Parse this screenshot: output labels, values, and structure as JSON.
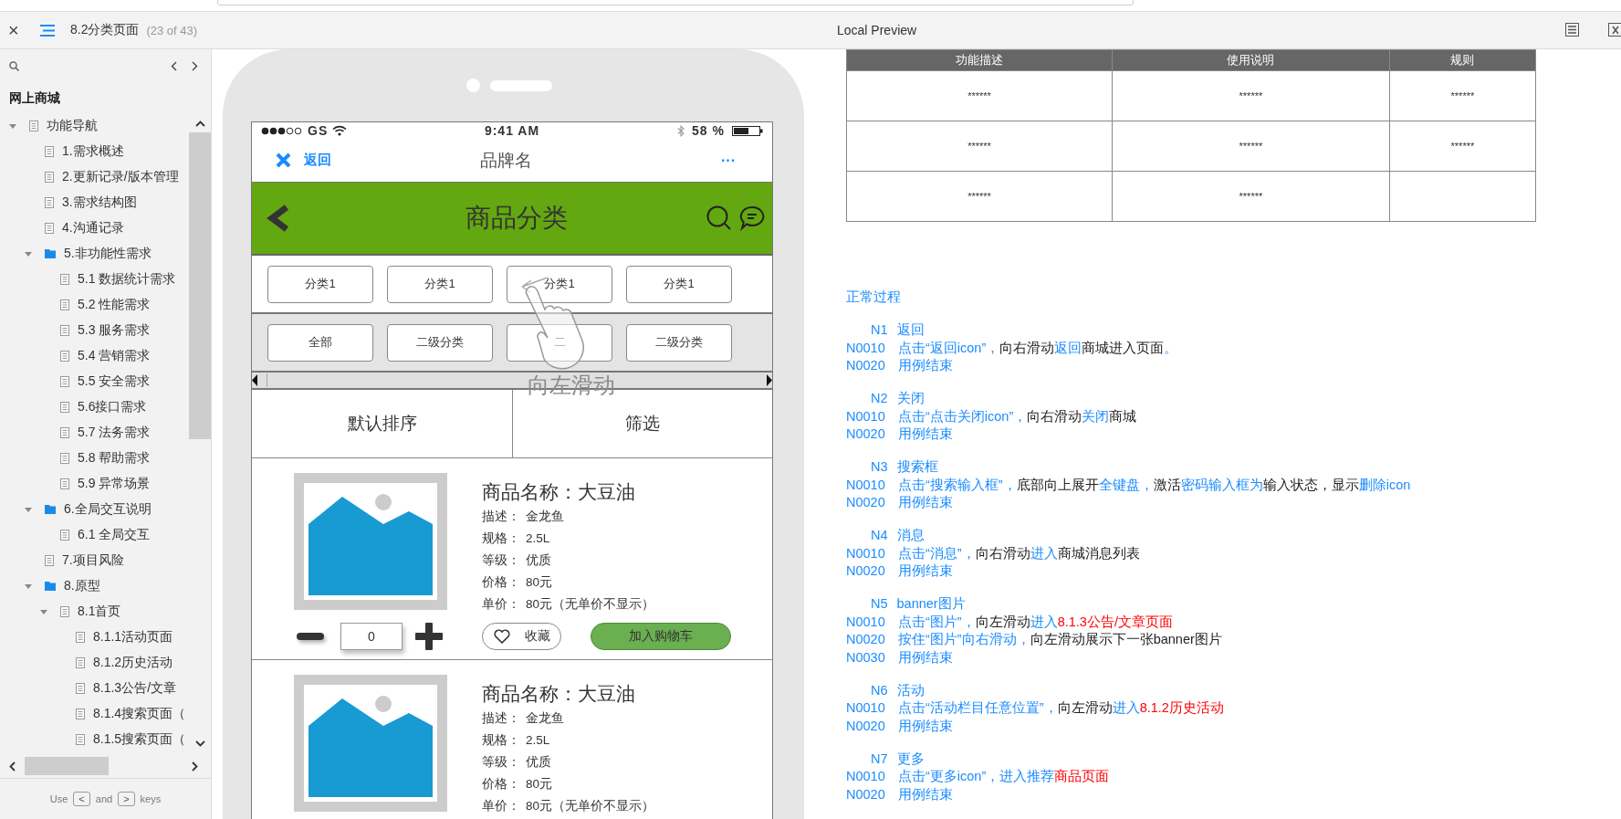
{
  "toolbar": {
    "close": "×",
    "page_title": "8.2分类页面",
    "page_count": "(23 of 43)",
    "center_title": "Local Preview"
  },
  "sidebar": {
    "project": "网上商城",
    "tree": [
      {
        "label": "功能导航",
        "kind": "page",
        "expanded": true,
        "children": [
          {
            "label": "1.需求概述",
            "kind": "page"
          },
          {
            "label": "2.更新记录/版本管理",
            "kind": "page"
          },
          {
            "label": "3.需求结构图",
            "kind": "page"
          },
          {
            "label": "4.沟通记录",
            "kind": "page"
          },
          {
            "label": "5.非功能性需求",
            "kind": "folder",
            "expanded": true,
            "children": [
              {
                "label": "5.1 数据统计需求",
                "kind": "page"
              },
              {
                "label": "5.2 性能需求",
                "kind": "page"
              },
              {
                "label": "5.3 服务需求",
                "kind": "page"
              },
              {
                "label": "5.4 营销需求",
                "kind": "page"
              },
              {
                "label": "5.5 安全需求",
                "kind": "page"
              },
              {
                "label": "5.6接口需求",
                "kind": "page"
              },
              {
                "label": "5.7 法务需求",
                "kind": "page"
              },
              {
                "label": "5.8 帮助需求",
                "kind": "page"
              },
              {
                "label": "5.9 异常场景",
                "kind": "page"
              }
            ]
          },
          {
            "label": "6.全局交互说明",
            "kind": "folder",
            "expanded": true,
            "children": [
              {
                "label": "6.1 全局交互",
                "kind": "page"
              }
            ]
          },
          {
            "label": "7.项目风险",
            "kind": "page"
          },
          {
            "label": "8.原型",
            "kind": "folder",
            "expanded": true,
            "children": [
              {
                "label": "8.1首页",
                "kind": "page",
                "expanded": true,
                "children": [
                  {
                    "label": "8.1.1活动页面",
                    "kind": "page"
                  },
                  {
                    "label": "8.1.2历史活动",
                    "kind": "page"
                  },
                  {
                    "label": "8.1.3公告/文章",
                    "kind": "page"
                  },
                  {
                    "label": "8.1.4搜索页面（",
                    "kind": "page"
                  },
                  {
                    "label": "8.1.5搜索页面（",
                    "kind": "page"
                  }
                ]
              }
            ]
          }
        ]
      }
    ],
    "footer": {
      "use": "Use",
      "prev_key": "<",
      "and": "and",
      "next_key": ">",
      "keys": "keys"
    }
  },
  "phone": {
    "status": {
      "carrier": "GS",
      "time": "9:41 AM",
      "battery": "58 %"
    },
    "nav": {
      "back_label": "返回",
      "title": "品牌名",
      "more": "···"
    },
    "header": {
      "title": "商品分类"
    },
    "categories": [
      "分类1",
      "分类1",
      "分类1",
      "分类1"
    ],
    "subcategories": [
      "全部",
      "二级分类",
      "二",
      "二级分类"
    ],
    "gesture_hint": "向左滑动",
    "sort": [
      "默认排序",
      "筛选"
    ],
    "products": [
      {
        "name": "商品名称：大豆油",
        "details": [
          {
            "label": "描述：",
            "value": "金龙鱼"
          },
          {
            "label": "规格：",
            "value": "2.5L"
          },
          {
            "label": "等级：",
            "value": "优质"
          },
          {
            "label": "价格：",
            "value": "80元"
          },
          {
            "label": "单价：",
            "value": "80元（无单价不显示）"
          }
        ],
        "quantity": "0",
        "favorite": "收藏",
        "add_to_cart": "加入购物车"
      },
      {
        "name": "商品名称：大豆油",
        "details": [
          {
            "label": "描述：",
            "value": "金龙鱼"
          },
          {
            "label": "规格：",
            "value": "2.5L"
          },
          {
            "label": "等级：",
            "value": "优质"
          },
          {
            "label": "价格：",
            "value": "80元"
          },
          {
            "label": "单价：",
            "value": "80元（无单价不显示）"
          }
        ]
      }
    ]
  },
  "spec_table": {
    "columns": [
      "功能描述",
      "使用说明",
      "规则"
    ],
    "rows": [
      [
        "******",
        "******",
        "******"
      ],
      [
        "******",
        "******",
        "******"
      ],
      [
        "******",
        "******"
      ]
    ]
  },
  "flow": {
    "title": "正常过程",
    "groups": [
      {
        "id": "N1",
        "title": "返回",
        "steps": [
          {
            "code": "N0010",
            "parts": [
              {
                "kind": "link",
                "text": "点击“返回icon”，"
              },
              {
                "kind": "plain",
                "text": "向右滑动"
              },
              {
                "kind": "link",
                "text": "返回"
              },
              {
                "kind": "plain",
                "text": "商城进入页面"
              },
              {
                "kind": "link",
                "text": "。"
              }
            ]
          },
          {
            "code": "N0020",
            "parts": [
              {
                "kind": "link",
                "text": "用例结束"
              }
            ]
          }
        ]
      },
      {
        "id": "N2",
        "title": "关闭",
        "steps": [
          {
            "code": "N0010",
            "parts": [
              {
                "kind": "link",
                "text": "点击“点击关闭icon”，"
              },
              {
                "kind": "plain",
                "text": "向右滑动"
              },
              {
                "kind": "link",
                "text": "关闭"
              },
              {
                "kind": "plain",
                "text": "商城"
              }
            ]
          },
          {
            "code": "N0020",
            "parts": [
              {
                "kind": "link",
                "text": "用例结束"
              }
            ]
          }
        ]
      },
      {
        "id": "N3",
        "title": "搜索框",
        "steps": [
          {
            "code": "N0010",
            "parts": [
              {
                "kind": "link",
                "text": "点击“搜索输入框”，"
              },
              {
                "kind": "plain",
                "text": "底部向上展开"
              },
              {
                "kind": "link",
                "text": "全键盘，"
              },
              {
                "kind": "plain",
                "text": "激活"
              },
              {
                "kind": "link",
                "text": "密码输入框为"
              },
              {
                "kind": "plain",
                "text": "输入状态，显示"
              },
              {
                "kind": "link",
                "text": "删除icon"
              }
            ]
          },
          {
            "code": "N0020",
            "parts": [
              {
                "kind": "link",
                "text": "用例结束"
              }
            ]
          }
        ]
      },
      {
        "id": "N4",
        "title": "消息",
        "steps": [
          {
            "code": "N0010",
            "parts": [
              {
                "kind": "link",
                "text": "点击“消息”，"
              },
              {
                "kind": "plain",
                "text": "向右滑动"
              },
              {
                "kind": "link",
                "text": "进入"
              },
              {
                "kind": "plain",
                "text": "商城消息列表"
              }
            ]
          },
          {
            "code": "N0020",
            "parts": [
              {
                "kind": "link",
                "text": "用例结束"
              }
            ]
          }
        ]
      },
      {
        "id": "N5",
        "title": "banner图片",
        "steps": [
          {
            "code": "N0010",
            "parts": [
              {
                "kind": "link",
                "text": "点击“图片”，"
              },
              {
                "kind": "plain",
                "text": "向左滑动"
              },
              {
                "kind": "link",
                "text": "进入"
              },
              {
                "kind": "ref",
                "text": "8.1.3公告/文章页面"
              }
            ]
          },
          {
            "code": "N0020",
            "parts": [
              {
                "kind": "link",
                "text": "按住“图片”向右滑动，"
              },
              {
                "kind": "plain",
                "text": "向左滑动展示下一张banner图片"
              }
            ]
          },
          {
            "code": "N0030",
            "parts": [
              {
                "kind": "link",
                "text": "用例结束"
              }
            ]
          }
        ]
      },
      {
        "id": "N6",
        "title": "活动",
        "steps": [
          {
            "code": "N0010",
            "parts": [
              {
                "kind": "link",
                "text": "点击“活动栏目任意位置”，"
              },
              {
                "kind": "plain",
                "text": "向左滑动"
              },
              {
                "kind": "link",
                "text": "进入"
              },
              {
                "kind": "ref",
                "text": "8.1.2历史活动"
              }
            ]
          },
          {
            "code": "N0020",
            "parts": [
              {
                "kind": "link",
                "text": "用例结束"
              }
            ]
          }
        ]
      },
      {
        "id": "N7",
        "title": "更多",
        "steps": [
          {
            "code": "N0010",
            "parts": [
              {
                "kind": "link",
                "text": "点击“更多icon”，进入推荐"
              },
              {
                "kind": "ref",
                "text": "商品页面"
              }
            ]
          },
          {
            "code": "N0020",
            "parts": [
              {
                "kind": "link",
                "text": "用例结束"
              }
            ]
          }
        ]
      }
    ]
  }
}
